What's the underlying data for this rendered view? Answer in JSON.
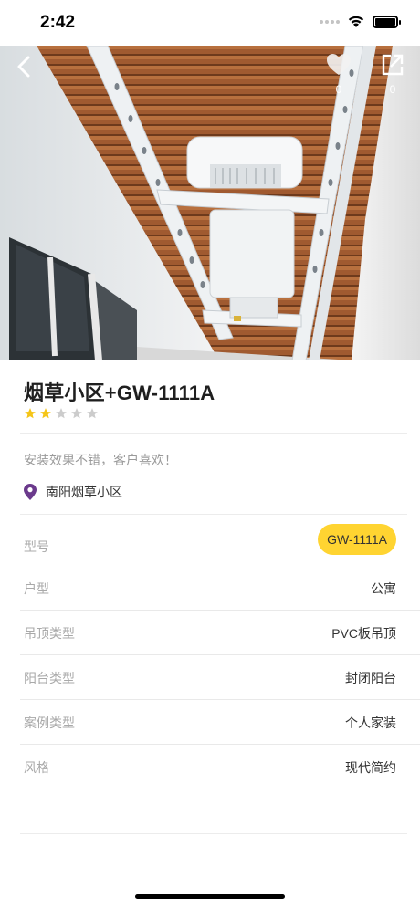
{
  "status": {
    "time": "2:42"
  },
  "hero": {
    "like_count": "0",
    "share_count": "0"
  },
  "case": {
    "title": "烟草小区+GW-1111A",
    "rating": 2,
    "rating_max": 5,
    "description": "安装效果不错，客户喜欢！",
    "location": "南阳烟草小区"
  },
  "properties": [
    {
      "label": "型号",
      "value": "GW-1111A"
    },
    {
      "label": "户型",
      "value": "公寓"
    },
    {
      "label": "吊顶类型",
      "value": "PVC板吊顶"
    },
    {
      "label": "阳台类型",
      "value": "封闭阳台"
    },
    {
      "label": "案例类型",
      "value": "个人家装"
    },
    {
      "label": "风格",
      "value": "现代简约"
    }
  ],
  "colors": {
    "accent_yellow": "#ffd431",
    "star_active": "#f5c518",
    "star_inactive": "#cccccc",
    "location_pin": "#6b3a8c"
  },
  "icons": {
    "back": "chevron-left-icon",
    "like": "heart-icon",
    "share": "share-icon",
    "location": "map-pin-icon"
  }
}
